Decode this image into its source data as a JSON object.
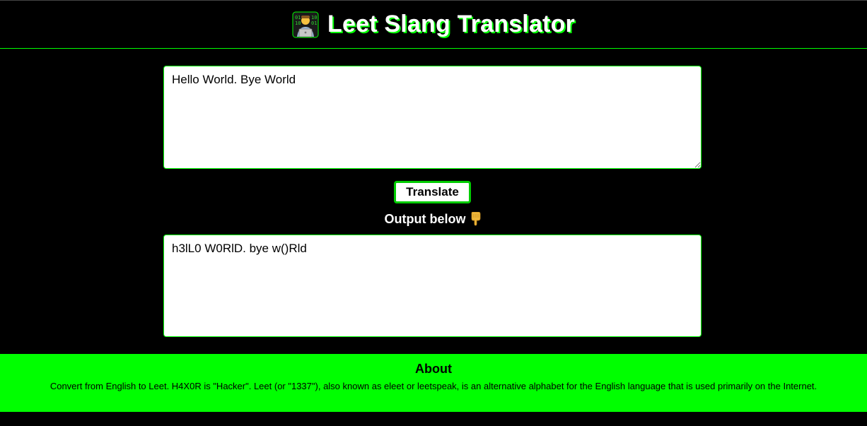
{
  "header": {
    "title": "Leet Slang Translator",
    "logo_icon": "technologist-emoji-icon"
  },
  "input": {
    "value": "Hello World. Bye World"
  },
  "translate_button": {
    "label": "Translate"
  },
  "output": {
    "label": "Output below",
    "label_icon": "pointing-down-emoji-icon",
    "value": "h3lL0 W0RlD. bye w()Rld"
  },
  "footer": {
    "heading": "About",
    "text": "Convert from English to Leet. H4X0R is \"Hacker\". Leet (or \"1337\"), also known as eleet or leetspeak, is an alternative alphabet for the English language that is used primarily on the Internet."
  },
  "colors": {
    "background": "#000000",
    "accent": "#00ff00",
    "panel": "#ffffff"
  }
}
